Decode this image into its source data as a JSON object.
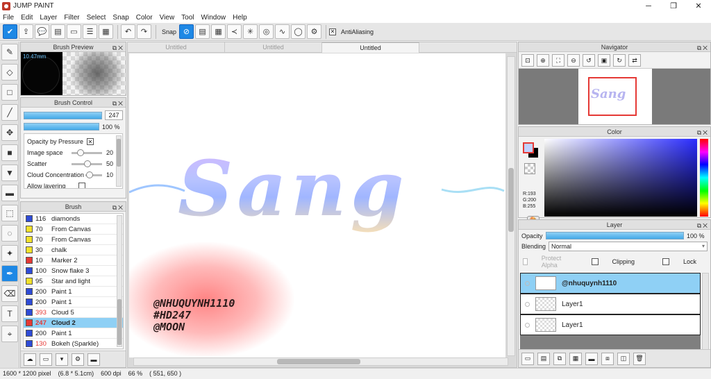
{
  "app": {
    "title": "JUMP PAINT"
  },
  "window_controls": [
    "─",
    "❐",
    "✕"
  ],
  "menu": [
    "File",
    "Edit",
    "Layer",
    "Filter",
    "Select",
    "Snap",
    "Color",
    "View",
    "Tool",
    "Window",
    "Help"
  ],
  "toolbar": {
    "snap_label": "Snap",
    "antialiasing_label": "AntiAliasing",
    "antialiasing_checked": "✕"
  },
  "brush_preview": {
    "title": "Brush Preview",
    "size_label": "10.47mm"
  },
  "brush_control": {
    "title": "Brush Control",
    "size_value": "247",
    "opacity_value": "100 %",
    "opacity_by_pressure_label": "Opacity by Pressure",
    "opacity_by_pressure_checked": "✕",
    "params": [
      {
        "name": "Image space",
        "value": "20",
        "level": 0.2
      },
      {
        "name": "Scatter",
        "value": "50",
        "level": 0.5
      },
      {
        "name": "Cloud Concentration",
        "value": "10",
        "level": 0.1
      }
    ],
    "allow_layering_label": "Allow layering"
  },
  "brush_list": {
    "title": "Brush",
    "items": [
      {
        "size": "116",
        "name": "diamonds",
        "color": "#2e4bd6"
      },
      {
        "size": "70",
        "name": "From Canvas",
        "color": "#f2e12b"
      },
      {
        "size": "70",
        "name": "From Canvas",
        "color": "#f2e12b"
      },
      {
        "size": "30",
        "name": "chalk",
        "color": "#f2e12b"
      },
      {
        "size": "10",
        "name": "Marker 2",
        "color": "#e53935"
      },
      {
        "size": "100",
        "name": "Snow flake 3",
        "color": "#2e4bd6"
      },
      {
        "size": "95",
        "name": "Star and light",
        "color": "#f2e12b"
      },
      {
        "size": "200",
        "name": "Paint 1",
        "color": "#2e4bd6"
      },
      {
        "size": "200",
        "name": "Paint 1",
        "color": "#2e4bd6"
      },
      {
        "size": "393",
        "name": "Cloud 5",
        "color": "#2e4bd6",
        "size_color": "#e53935"
      },
      {
        "size": "247",
        "name": "Cloud 2",
        "color": "#e53935",
        "size_color": "#e53935",
        "selected": true
      },
      {
        "size": "200",
        "name": "Paint 1",
        "color": "#2e4bd6"
      },
      {
        "size": "130",
        "name": "Bokeh (Sparkle)",
        "color": "#2e4bd6",
        "size_color": "#e53935"
      }
    ]
  },
  "canvas": {
    "tabs": [
      {
        "label": "Untitled",
        "active": false
      },
      {
        "label": "Untitled",
        "active": false
      },
      {
        "label": "Untitled",
        "active": true
      }
    ],
    "artwork_text": "Sang",
    "watermark_lines": [
      "@NHUQUYNH1110",
      "#HD247",
      "@MOON"
    ]
  },
  "navigator": {
    "title": "Navigator",
    "thumb_text": "Sang"
  },
  "color": {
    "title": "Color",
    "r": "R:193",
    "g": "G:200",
    "b": "B:255",
    "fg_color": "#c1c8ff"
  },
  "layer": {
    "title": "Layer",
    "opacity_label": "Opacity",
    "opacity_value": "100 %",
    "blending_label": "Blending",
    "blending_value": "Normal",
    "protect_alpha_label": "Protect Alpha",
    "clipping_label": "Clipping",
    "lock_label": "Lock",
    "layers": [
      {
        "name": "@nhuquynh1110",
        "selected": true
      },
      {
        "name": "Layer1",
        "selected": false
      },
      {
        "name": "Layer1",
        "selected": false
      }
    ]
  },
  "status": {
    "pixels": "1600 * 1200 pixel",
    "size": "(6.8 * 5.1cm)",
    "dpi": "600 dpi",
    "zoom": "66 %",
    "coords": "( 551, 650 )"
  },
  "colors": {
    "accent": "#1e88e5",
    "selection": "#8fd0f5"
  }
}
